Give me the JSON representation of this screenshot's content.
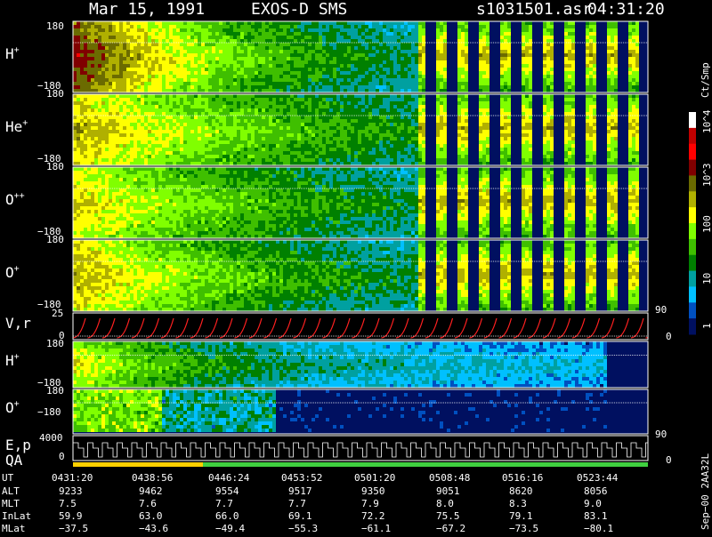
{
  "header": {
    "date": "Mar 15, 1991",
    "instrument": "EXOS-D SMS",
    "filename": "s1031501.asr",
    "time": "04:31:20"
  },
  "colorbar": {
    "unit": "Ct/Smp",
    "ticks": [
      "10^4",
      "10^3",
      "100",
      "10",
      "1"
    ],
    "colors": [
      "#ffffff",
      "#c00000",
      "#ff0000",
      "#800000",
      "#6b6b00",
      "#b0b000",
      "#ffff00",
      "#80ff00",
      "#3fbf00",
      "#008000",
      "#00a0a0",
      "#00c0ff",
      "#0050c0",
      "#001060"
    ]
  },
  "panels": {
    "hplus": {
      "label": "H",
      "sup": "+",
      "ytop": "180",
      "ybot": "−180"
    },
    "heplus": {
      "label": "He",
      "sup": "+",
      "ytop": "180",
      "ybot": "−180"
    },
    "oplusplus": {
      "label": "O",
      "sup": "++",
      "ytop": "180",
      "ybot": "−180"
    },
    "oplus": {
      "label": "O",
      "sup": "+",
      "ytop": "180",
      "ybot": "−180"
    },
    "vr": {
      "label": "V,r",
      "ytop": "25",
      "ybot": "0",
      "rtop": "90",
      "rbot": "0"
    },
    "hplus2": {
      "label": "H",
      "sup": "+",
      "ytop": "180",
      "ybot": "−180"
    },
    "oplus2": {
      "label": "O",
      "sup": "+",
      "ytop": "180",
      "ybot": "−180",
      "rbot": "90"
    },
    "ep": {
      "label": "E,p",
      "label2": "QA",
      "ytop": "4000",
      "ybot": "0",
      "rbot": "0"
    }
  },
  "table": {
    "row_labels": [
      "UT",
      "ALT",
      "MLT",
      "InLat",
      "MLat"
    ],
    "columns": [
      [
        "0431:20",
        "9233",
        "7.5",
        "59.9",
        "−37.5"
      ],
      [
        "0438:56",
        "9462",
        "7.6",
        "63.0",
        "−43.6"
      ],
      [
        "0446:24",
        "9554",
        "7.7",
        "66.0",
        "−49.4"
      ],
      [
        "0453:52",
        "9517",
        "7.7",
        "69.1",
        "−55.3"
      ],
      [
        "0501:20",
        "9350",
        "7.9",
        "72.2",
        "−61.1"
      ],
      [
        "0508:48",
        "9051",
        "8.0",
        "75.5",
        "−67.2"
      ],
      [
        "0516:16",
        "8620",
        "8.3",
        "79.1",
        "−73.5"
      ],
      [
        "0523:44",
        "8056",
        "9.0",
        "83.1",
        "−80.1"
      ]
    ]
  },
  "footer": {
    "vertical_text": "Sep−00  2AA32L"
  },
  "chart_data": {
    "type": "heatmap",
    "x": [
      "0431:20",
      "0438:56",
      "0446:24",
      "0453:52",
      "0501:20",
      "0508:48",
      "0516:16",
      "0523:44"
    ],
    "series": [
      {
        "name": "H+",
        "ylim": [
          -180,
          180
        ]
      },
      {
        "name": "He+",
        "ylim": [
          -180,
          180
        ]
      },
      {
        "name": "O++",
        "ylim": [
          -180,
          180
        ]
      },
      {
        "name": "O+",
        "ylim": [
          -180,
          180
        ]
      },
      {
        "name": "V,r",
        "ylim": [
          0,
          25
        ]
      },
      {
        "name": "H+",
        "ylim": [
          -180,
          180
        ]
      },
      {
        "name": "O+",
        "ylim": [
          -180,
          180
        ]
      },
      {
        "name": "E,p",
        "ylim": [
          0,
          4000
        ]
      }
    ],
    "colorbar_range": [
      1,
      10000
    ]
  }
}
